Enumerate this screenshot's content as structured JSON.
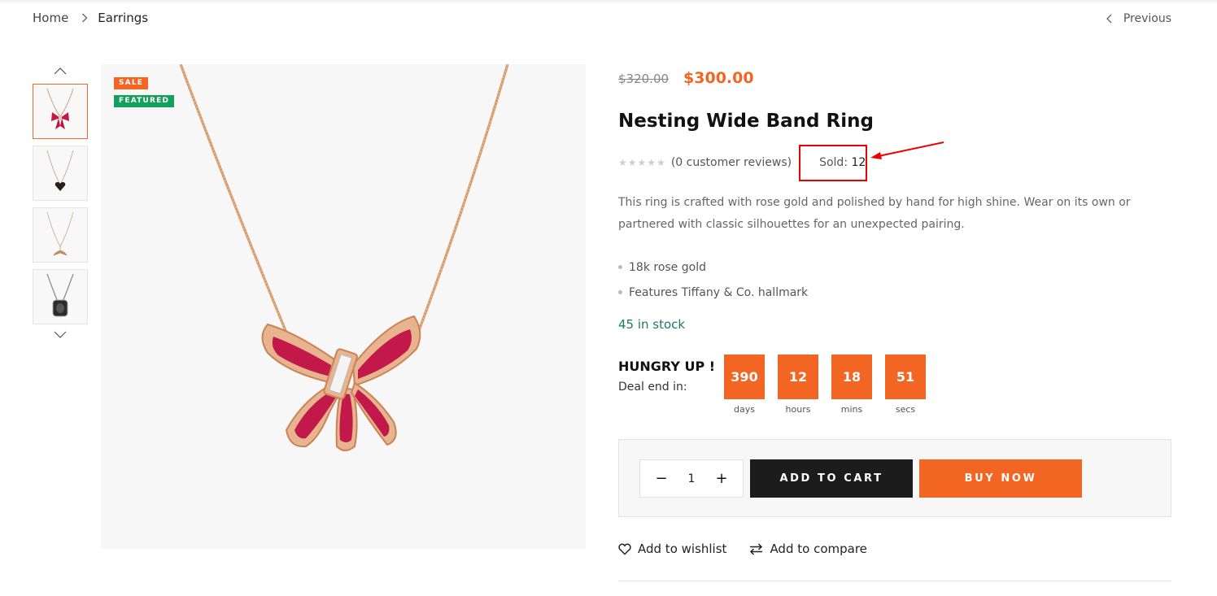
{
  "breadcrumb": {
    "home": "Home",
    "current": "Earrings"
  },
  "nav": {
    "previous": "Previous"
  },
  "badges": {
    "sale": "SALE",
    "featured": "FEATURED"
  },
  "product": {
    "old_price": "$320.00",
    "price": "$300.00",
    "title": "Nesting Wide Band Ring",
    "rating_value": 0,
    "reviews_text": "(0 customer reviews)",
    "sold_label": "Sold:",
    "sold_count": "12",
    "description": "This ring is crafted with rose gold and polished by hand for high shine. Wear on its own or partnered with classic silhouettes for an unexpected pairing.",
    "features": [
      "18k rose gold",
      "Features Tiffany & Co. hallmark"
    ],
    "stock": "45 in stock"
  },
  "deal": {
    "title": "HUNGRY UP !",
    "subtitle": "Deal end in:",
    "countdown": [
      {
        "value": "390",
        "label": "days"
      },
      {
        "value": "12",
        "label": "hours"
      },
      {
        "value": "18",
        "label": "mins"
      },
      {
        "value": "51",
        "label": "secs"
      }
    ]
  },
  "cart": {
    "quantity": "1",
    "minus": "−",
    "plus": "+",
    "add_to_cart": "ADD TO CART",
    "buy_now": "BUY NOW"
  },
  "actions": {
    "wishlist": "Add to wishlist",
    "compare": "Add to compare"
  },
  "colors": {
    "accent": "#f26522",
    "featured": "#14a05a",
    "stock": "#1e7a63",
    "dark_button": "#1c1c1c",
    "highlight": "#e00000"
  }
}
